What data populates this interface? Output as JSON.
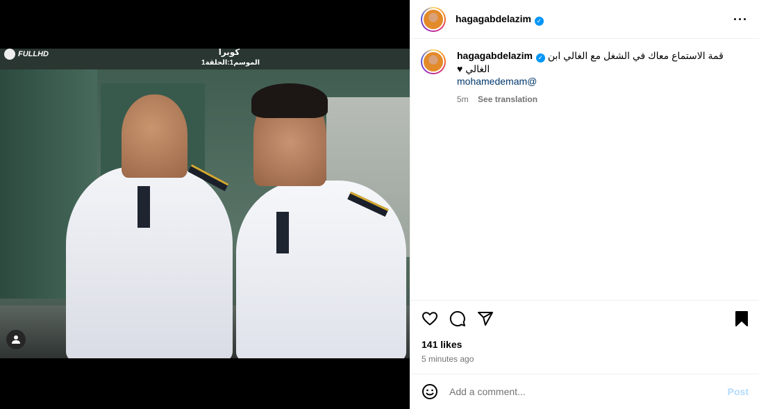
{
  "post": {
    "username": "hagagabdelazim",
    "verified": true,
    "caption": "قمة الاستماع معاك في الشغل مع الغالي ابن الغالي ♥",
    "mention": "mohamedemam@",
    "comment_time": "5m",
    "see_translation": "See translation",
    "likes": "141 likes",
    "posted_ago": "5 minutes ago"
  },
  "media": {
    "logo_text": "FULLHD",
    "show_title": "كوبرا",
    "episode_info": "الموسم1:الحلقة1"
  },
  "comment_box": {
    "placeholder": "Add a comment...",
    "post_label": "Post"
  },
  "icons": {
    "more": "more-options-icon",
    "like": "heart-icon",
    "comment": "comment-icon",
    "share": "share-icon",
    "save": "bookmark-icon",
    "emoji": "emoji-icon",
    "tag": "user-tag-icon"
  },
  "colors": {
    "verified": "#0095f6",
    "mention": "#00376b",
    "post_button": "#b3dbff",
    "secondary_text": "#737373"
  }
}
